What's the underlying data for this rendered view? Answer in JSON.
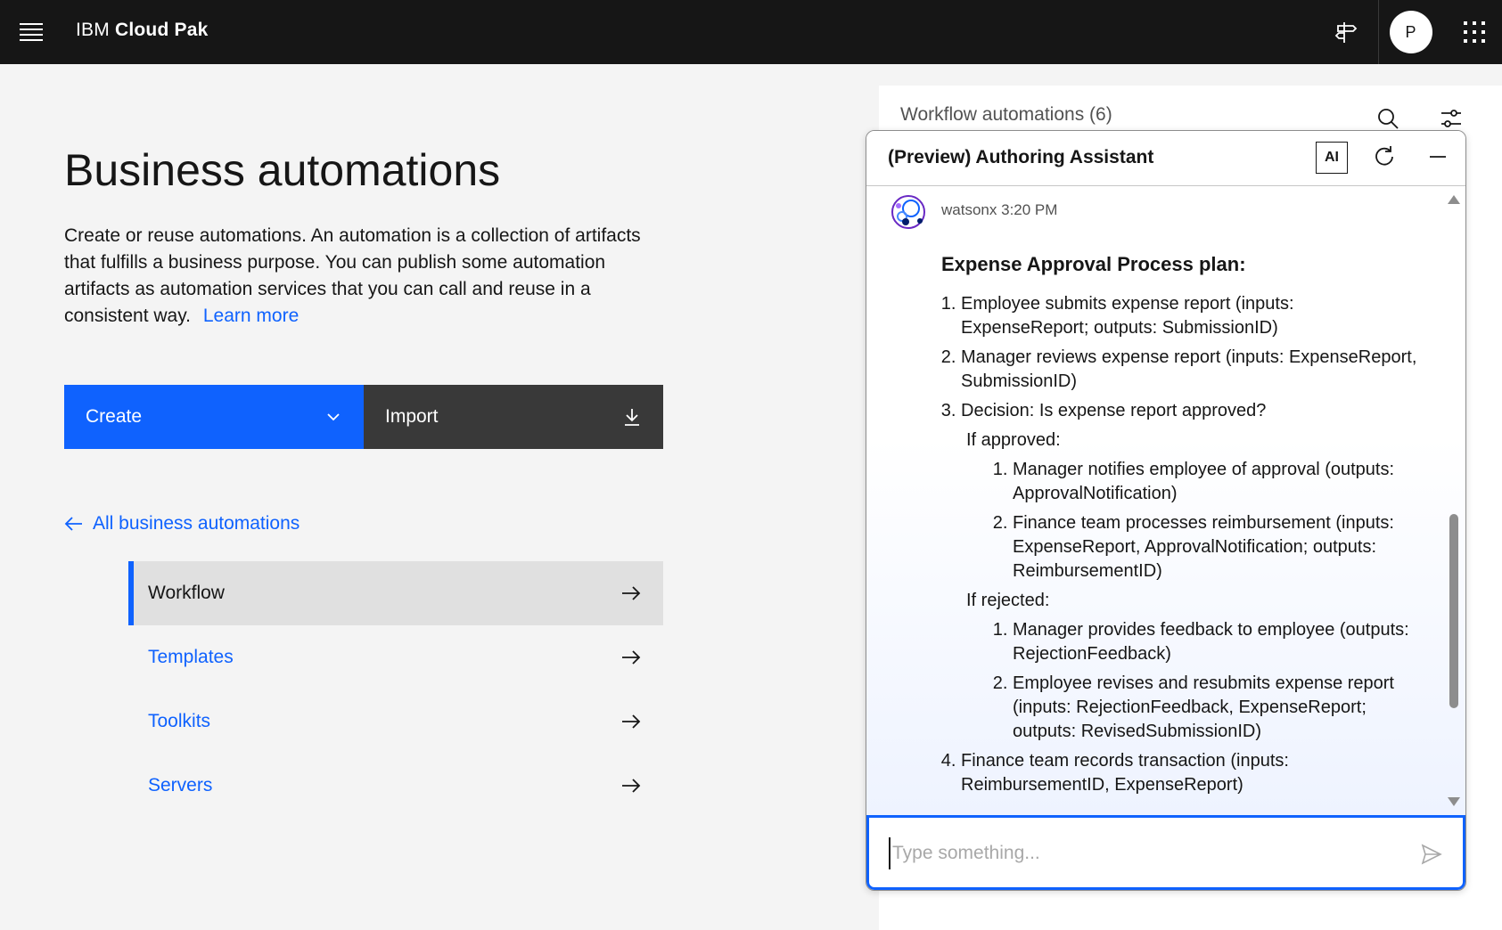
{
  "topbar": {
    "brand_prefix": "IBM",
    "brand_name": "Cloud Pak",
    "avatar_initial": "P"
  },
  "main": {
    "title": "Business automations",
    "description": "Create or reuse automations. An automation is a collection of artifacts that fulfills a business purpose. You can publish some automation artifacts as automation services that you can call and reuse in a consistent way.",
    "learn_more": "Learn more",
    "create_label": "Create",
    "import_label": "Import",
    "back_link": "All business automations",
    "nav_items": [
      {
        "label": "Workflow",
        "active": true
      },
      {
        "label": "Templates",
        "active": false
      },
      {
        "label": "Toolkits",
        "active": false
      },
      {
        "label": "Servers",
        "active": false
      }
    ]
  },
  "right_panel": {
    "title": "Workflow automations (6)"
  },
  "assistant": {
    "title": "(Preview) Authoring Assistant",
    "ai_badge": "AI",
    "sender": "watsonx",
    "time": "3:20 PM",
    "plan_title": "Expense Approval Process plan:",
    "steps": [
      "Employee submits expense report (inputs: ExpenseReport; outputs: SubmissionID)",
      "Manager reviews expense report (inputs: ExpenseReport, SubmissionID)",
      "Decision: Is expense report approved?",
      "Finance team records transaction (inputs: ReimbursementID, ExpenseReport)"
    ],
    "if_approved_label": "If approved:",
    "approved_steps": [
      "Manager notifies employee of approval (outputs: ApprovalNotification)",
      "Finance team processes reimbursement (inputs: ExpenseReport, ApprovalNotification; outputs: ReimbursementID)"
    ],
    "if_rejected_label": "If rejected:",
    "rejected_steps": [
      "Manager provides feedback to employee (outputs: RejectionFeedback)",
      "Employee revises and resubmits expense report (inputs: RejectionFeedback, ExpenseReport; outputs: RevisedSubmissionID)"
    ],
    "input_placeholder": "Type something...",
    "input_value": ""
  },
  "colors": {
    "accent": "#0f62fe",
    "topbar": "#161616",
    "import_bg": "#393939",
    "active_nav_bg": "#e0e0e0"
  },
  "icons": [
    "menu-icon",
    "signpost-icon",
    "app-switcher-icon",
    "chevron-down-icon",
    "download-icon",
    "arrow-left-icon",
    "arrow-right-icon",
    "search-icon",
    "settings-adjust-icon",
    "refresh-icon",
    "minimize-icon",
    "watsonx-avatar-icon",
    "send-icon"
  ]
}
